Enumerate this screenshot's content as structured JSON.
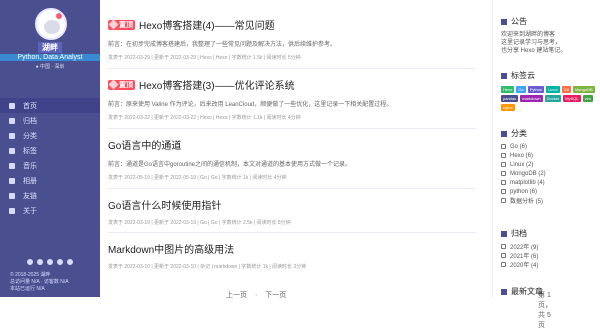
{
  "sidebar": {
    "name": "湖畔",
    "subtitle": "Python, Data Analyst",
    "location": "● 中国 · 深圳",
    "nav": [
      {
        "label": "首页",
        "active": true
      },
      {
        "label": "归档"
      },
      {
        "label": "分类"
      },
      {
        "label": "标签"
      },
      {
        "label": "音乐"
      },
      {
        "label": "相册"
      },
      {
        "label": "友链"
      },
      {
        "label": "关于"
      }
    ],
    "footer_lines": [
      "© 2018-2025 湖畔",
      "总访问量 N/A · 访客数 N/A",
      "本站已运行 N/A"
    ]
  },
  "main": {
    "posts": [
      {
        "badge": "置顶",
        "title": "Hexo博客搭建(4)——常见问题",
        "excerpt": "前言：在初步完成博客搭建后，我整理了一些常见问题及解决方法，供后续维护参考。",
        "meta": "发表于 2022-03-29 | 更新于 2022-03-29 | Hexo | Hexo | 字数统计 1.5k | 阅读时长 5分钟"
      },
      {
        "badge": "置顶",
        "title": "Hexo博客搭建(3)——优化评论系统",
        "excerpt": "前言：原来使用 Valine 作为评论，后来改用 LeanCloud，顺便做了一些优化，这里记录一下相关配置过程。",
        "meta": "发表于 2022-03-22 | 更新于 2022-03-22 | Hexo | Hexo | 字数统计 1.1k | 阅读时长 4分钟"
      },
      {
        "title": "Go语言中的通道",
        "excerpt": "前言：通道是Go语言中goroutine之间的通信机制，本文对通道的基本使用方式做一个记录。",
        "meta": "发表于 2022-05-19 | 更新于 2022-05-19 | Go | Go | 字数统计 1k | 阅读时长 4分钟"
      },
      {
        "title": "Go语言什么时候使用指针",
        "excerpt": "",
        "meta": "发表于 2022-03-19 | 更新于 2022-03-19 | Go | Go | 字数统计 2.5k | 阅读时长 8分钟"
      },
      {
        "title": "Markdown中图片的高级用法",
        "excerpt": "",
        "meta": "发表于 2022-03-10 | 更新于 2022-03-10 | 杂记 | markdown | 字数统计 1k | 阅读时长 3分钟"
      }
    ],
    "pagination": {
      "prev": "上一页",
      "next": "下一页",
      "status": "第 1 页，共 5 页"
    }
  },
  "right": {
    "notice_title": "公告",
    "notice_lines": [
      "欢迎来到湖畔的博客",
      "这里记录学习与思考，",
      "也分享 Hexo 建站笔记。"
    ],
    "tags_title": "标签云",
    "tags": [
      {
        "label": "Hexo",
        "color": "#2bbf6a"
      },
      {
        "label": "Go",
        "color": "#3ea3ff"
      },
      {
        "label": "Python",
        "color": "#6a5acd"
      },
      {
        "label": "Linux",
        "color": "#00b3a4"
      },
      {
        "label": "Git",
        "color": "#ff7043"
      },
      {
        "label": "MongoDB",
        "color": "#7cb342"
      },
      {
        "label": "pandas",
        "color": "#4a4f8f"
      },
      {
        "label": "markdown",
        "color": "#9c27b0"
      },
      {
        "label": "Docker",
        "color": "#26a69a"
      },
      {
        "label": "MySQL",
        "color": "#e91e63"
      },
      {
        "label": "vim",
        "color": "#43a047"
      },
      {
        "label": "nginx",
        "color": "#ff9800"
      }
    ],
    "categories_title": "分类",
    "categories": [
      "Go (6)",
      "Hexo (6)",
      "Linux (2)",
      "MongoDB (2)",
      "matplotlib (4)",
      "python (6)",
      "数据分析 (5)"
    ],
    "archive_title": "归档",
    "archive": [
      "2022年 (9)",
      "2021年 (6)",
      "2020年 (4)"
    ],
    "latest_title": "最新文章"
  }
}
